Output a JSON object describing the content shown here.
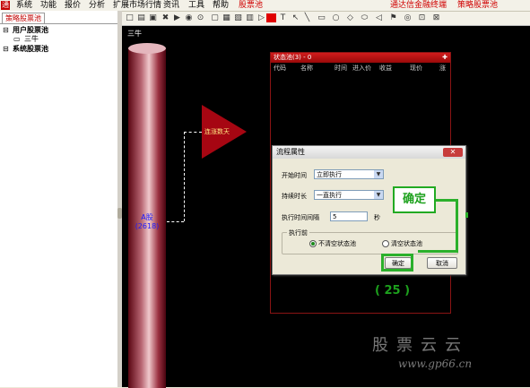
{
  "menubar": {
    "items": [
      "系统",
      "功能",
      "报价",
      "分析",
      "扩展市场行情",
      "资讯",
      "工具",
      "帮助",
      "股票池"
    ],
    "right_items": [
      "通达信金融终端",
      "策略股票池"
    ]
  },
  "left_panel": {
    "tab": "策略股票池",
    "tree": {
      "user_pool": "用户股票池",
      "user_child": "三牛",
      "system_pool": "系统股票池"
    }
  },
  "canvas": {
    "caption": "三牛",
    "pillar_label_line1": "A股",
    "pillar_label_line2": "(2618)",
    "triangle_label": "连涨数天"
  },
  "status_window": {
    "title": "状态池(3) - 0",
    "close": "✚",
    "columns": [
      "代码",
      "名称",
      "时间",
      "进入价",
      "收益",
      "现价",
      "涨"
    ]
  },
  "dialog": {
    "title": "流程属性",
    "close": "✕",
    "start_time_label": "开始时间",
    "start_time_value": "立即执行",
    "duration_label": "持续时长",
    "duration_value": "一直执行",
    "interval_label": "执行时间间隔",
    "interval_value": "5",
    "interval_unit": "秒",
    "before_group": "执行前",
    "radio_keep": "不清空状态池",
    "radio_clear": "清空状态池",
    "ok": "确定",
    "cancel": "取消"
  },
  "annotation": {
    "callout": "确定",
    "step": "( 25 )",
    "color": "#1da11d"
  },
  "watermark": {
    "line1": "股票云云",
    "line2": "www.gp66.cn"
  }
}
